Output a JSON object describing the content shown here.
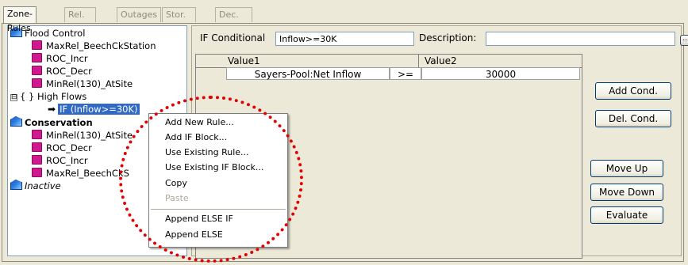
{
  "tabs": [
    "Zone-Rules",
    "Rel. Alloc.",
    "Outages",
    "Stor. Credit",
    "Dec. Sched."
  ],
  "tree": {
    "flood_control": "Flood Control",
    "fc_rules": [
      "MaxRel_BeechCkStation",
      "ROC_Incr",
      "ROC_Decr",
      "MinRel(130)_AtSite"
    ],
    "high_flows_expander": "⊟",
    "high_flows": "{ } High Flows",
    "if_node": "IF (Inflow>=30K)",
    "conservation": "Conservation",
    "cons_rules": [
      "MinRel(130)_AtSite",
      "ROC_Decr",
      "ROC_Incr",
      "MaxRel_BeechCkS"
    ],
    "inactive": "Inactive"
  },
  "conditional": {
    "label": "IF Conditional",
    "value": "Inflow>=30K",
    "desc_label": "Description:",
    "desc_value": ""
  },
  "grid": {
    "headers": [
      "Value1",
      "Value2"
    ],
    "row": {
      "value1": "Sayers-Pool:Net Inflow",
      "op": ">=",
      "value2": "30000"
    }
  },
  "buttons": {
    "add_cond": "Add Cond.",
    "del_cond": "Del. Cond.",
    "move_up": "Move Up",
    "move_down": "Move Down",
    "evaluate": "Evaluate",
    "ellipsis": "..."
  },
  "context_menu": {
    "items": [
      "Add New Rule...",
      "Add IF Block...",
      "Use Existing Rule...",
      "Use Existing IF Block...",
      "Copy",
      "Paste",
      "Append ELSE IF",
      "Append ELSE"
    ],
    "disabled": [
      "Paste"
    ]
  },
  "colors": {
    "selection": "#316ac5",
    "rule_icon": "#d1198f",
    "highlight_circle": "#e40000"
  }
}
